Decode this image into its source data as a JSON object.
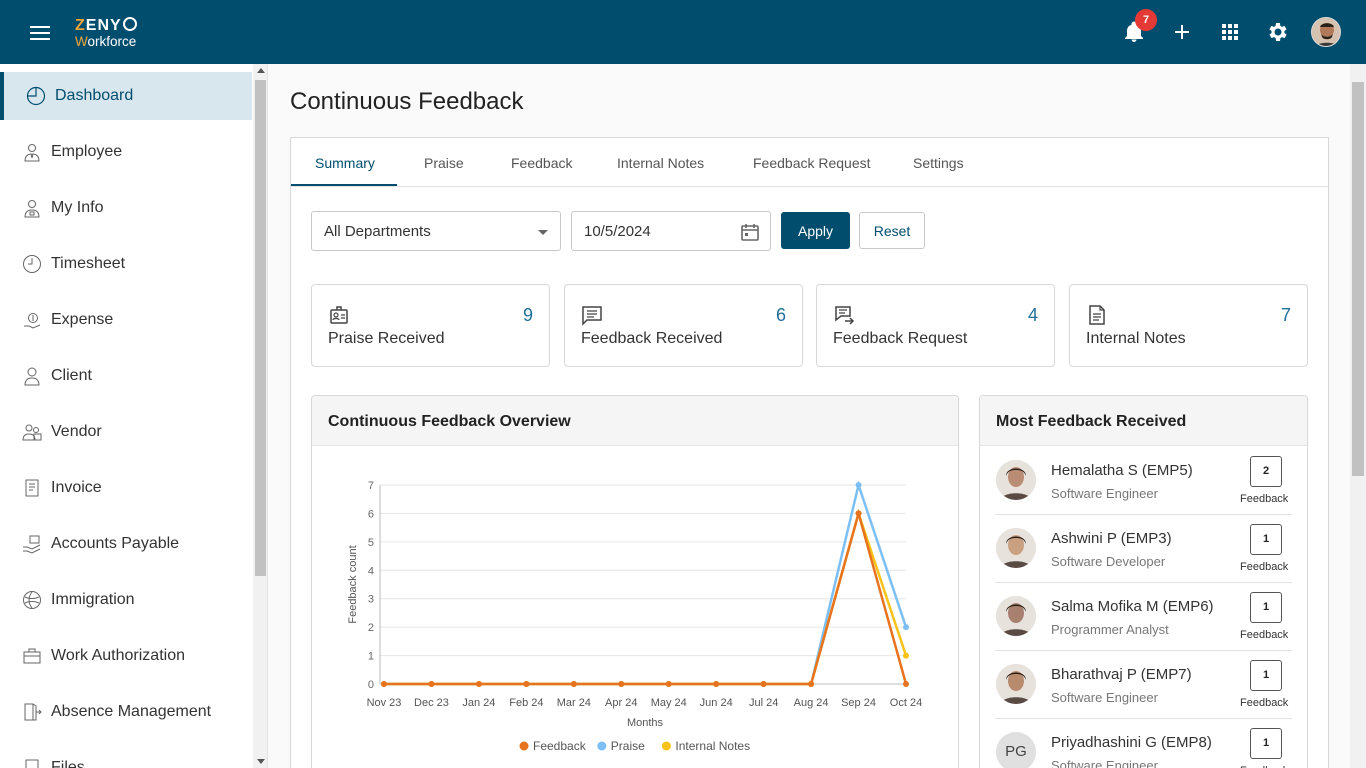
{
  "app": {
    "logo_line1_first": "Z",
    "logo_line1_rest": "ENY",
    "logo_line2_first": "W",
    "logo_line2_rest": "orkforce",
    "notification_count": "7"
  },
  "sidebar": {
    "items": [
      {
        "label": "Dashboard",
        "icon": "dashboard-icon",
        "active": true
      },
      {
        "label": "Employee",
        "icon": "employee-icon"
      },
      {
        "label": "My Info",
        "icon": "my-info-icon"
      },
      {
        "label": "Timesheet",
        "icon": "clock-icon"
      },
      {
        "label": "Expense",
        "icon": "expense-icon"
      },
      {
        "label": "Client",
        "icon": "client-icon"
      },
      {
        "label": "Vendor",
        "icon": "vendor-icon"
      },
      {
        "label": "Invoice",
        "icon": "invoice-icon"
      },
      {
        "label": "Accounts Payable",
        "icon": "accounts-payable-icon"
      },
      {
        "label": "Immigration",
        "icon": "globe-icon"
      },
      {
        "label": "Work Authorization",
        "icon": "briefcase-icon"
      },
      {
        "label": "Absence Management",
        "icon": "exit-door-icon"
      },
      {
        "label": "Files",
        "icon": "files-icon"
      }
    ]
  },
  "page": {
    "title": "Continuous Feedback"
  },
  "tabs": [
    "Summary",
    "Praise",
    "Feedback",
    "Internal Notes",
    "Feedback Request",
    "Settings"
  ],
  "filters": {
    "department": "All Departments",
    "date": "10/5/2024",
    "apply_label": "Apply",
    "reset_label": "Reset"
  },
  "stats": [
    {
      "label": "Praise Received",
      "value": "9",
      "icon": "badge-icon"
    },
    {
      "label": "Feedback Received",
      "value": "6",
      "icon": "message-icon"
    },
    {
      "label": "Feedback Request",
      "value": "4",
      "icon": "request-icon"
    },
    {
      "label": "Internal Notes",
      "value": "7",
      "icon": "note-icon"
    }
  ],
  "overview": {
    "title": "Continuous Feedback Overview"
  },
  "chart_data": {
    "type": "line",
    "x": [
      "Nov 23",
      "Dec 23",
      "Jan 24",
      "Feb 24",
      "Mar 24",
      "Apr 24",
      "May 24",
      "Jun 24",
      "Jul 24",
      "Aug 24",
      "Sep 24",
      "Oct 24"
    ],
    "series": [
      {
        "name": "Feedback",
        "color": "#e8731e",
        "values": [
          0,
          0,
          0,
          0,
          0,
          0,
          0,
          0,
          0,
          0,
          6,
          0
        ]
      },
      {
        "name": "Praise",
        "color": "#7cbff5",
        "values": [
          0,
          0,
          0,
          0,
          0,
          0,
          0,
          0,
          0,
          0,
          7,
          2
        ]
      },
      {
        "name": "Internal Notes",
        "color": "#f7c31a",
        "values": [
          0,
          0,
          0,
          0,
          0,
          0,
          0,
          0,
          0,
          0,
          6,
          1
        ]
      }
    ],
    "xlabel": "Months",
    "ylabel": "Feedback count",
    "ylim": [
      0,
      7
    ],
    "yticks": [
      "0",
      "1",
      "2",
      "3",
      "4",
      "5",
      "6",
      "7"
    ],
    "grid": true,
    "legend": "bottom"
  },
  "most_feedback": {
    "title": "Most Feedback Received",
    "count_label": "Feedback",
    "people": [
      {
        "name": "Hemalatha S (EMP5)",
        "role": "Software Engineer",
        "count": "2",
        "avatar_color": "#b98c73"
      },
      {
        "name": "Ashwini P (EMP3)",
        "role": "Software Developer",
        "count": "1",
        "avatar_color": "#c9a080"
      },
      {
        "name": "Salma Mofika M (EMP6)",
        "role": "Programmer Analyst",
        "count": "1",
        "avatar_color": "#a88070"
      },
      {
        "name": "Bharathvaj P (EMP7)",
        "role": "Software Engineer",
        "count": "1",
        "avatar_color": "#b88a6e"
      },
      {
        "name": "Priyadhashini G (EMP8)",
        "role": "Software Engineer",
        "count": "1",
        "initials": "PG"
      }
    ]
  }
}
